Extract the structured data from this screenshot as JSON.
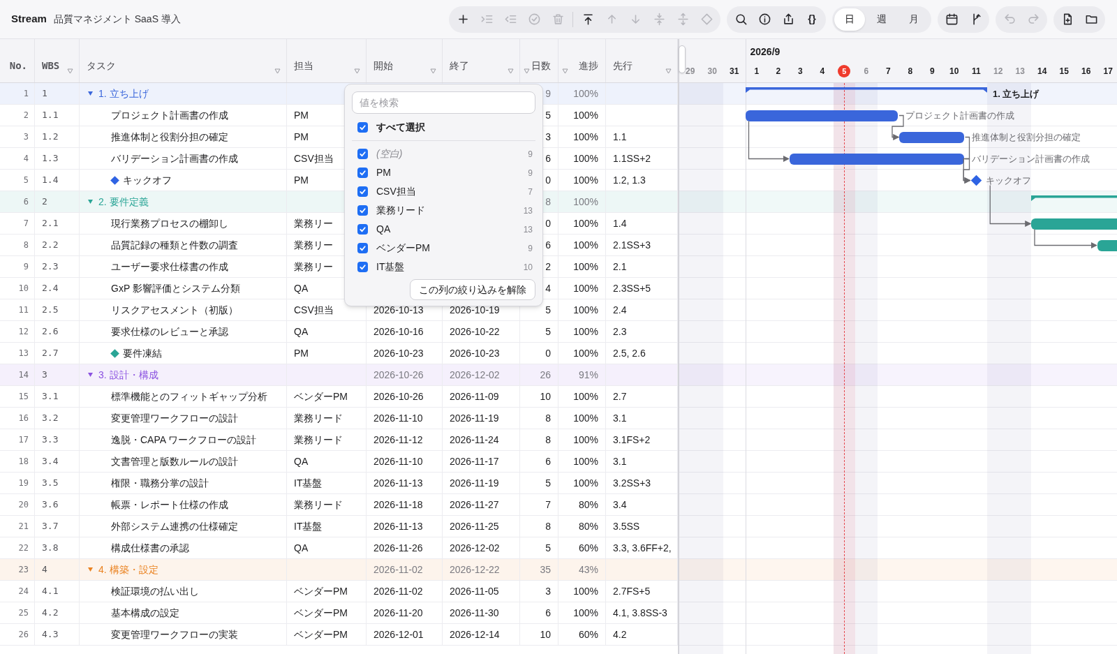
{
  "app": {
    "name": "Stream",
    "project": "品質マネジメント SaaS 導入"
  },
  "toolbar": {
    "groups": [
      {
        "kind": "icons",
        "items": [
          {
            "kind": "plus",
            "disabled": false
          },
          {
            "kind": "indent",
            "disabled": true
          },
          {
            "kind": "outdent",
            "disabled": true
          },
          {
            "kind": "check-circle",
            "disabled": true
          },
          {
            "kind": "trash",
            "disabled": true
          },
          {
            "kind": "separator"
          },
          {
            "kind": "move-top",
            "disabled": false
          },
          {
            "kind": "arrow-up",
            "disabled": true
          },
          {
            "kind": "arrow-down",
            "disabled": true
          },
          {
            "kind": "collapse",
            "disabled": true
          },
          {
            "kind": "expand",
            "disabled": true
          },
          {
            "kind": "diamond",
            "disabled": true
          }
        ]
      },
      {
        "kind": "icons",
        "items": [
          {
            "kind": "search",
            "disabled": false
          },
          {
            "kind": "info",
            "disabled": false
          },
          {
            "kind": "share",
            "disabled": false
          },
          {
            "kind": "text",
            "label": "{}",
            "disabled": false
          }
        ]
      },
      {
        "kind": "segmented",
        "options": [
          {
            "label": "日",
            "selected": true
          },
          {
            "label": "週",
            "selected": false
          },
          {
            "label": "月",
            "selected": false
          }
        ]
      },
      {
        "kind": "icons",
        "items": [
          {
            "kind": "calendar",
            "disabled": false
          },
          {
            "kind": "branch",
            "disabled": false
          }
        ]
      },
      {
        "kind": "icons",
        "items": [
          {
            "kind": "undo",
            "disabled": true
          },
          {
            "kind": "redo",
            "disabled": true
          }
        ]
      },
      {
        "kind": "icons",
        "items": [
          {
            "kind": "file-plus",
            "disabled": false
          },
          {
            "kind": "folder",
            "disabled": false
          }
        ]
      }
    ]
  },
  "table": {
    "columns": [
      {
        "label": "No.",
        "filter": false
      },
      {
        "label": "WBS",
        "filter": true
      },
      {
        "label": "タスク",
        "filter": true
      },
      {
        "label": "担当",
        "filter": true
      },
      {
        "label": "開始",
        "filter": true
      },
      {
        "label": "終了",
        "filter": true
      },
      {
        "label": "日数",
        "filter": true
      },
      {
        "label": "進捗",
        "filter": true
      },
      {
        "label": "先行",
        "filter": true
      }
    ],
    "rows": [
      {
        "kind": "group",
        "no": "1",
        "wbs": "1",
        "task": "1. 立ち上げ",
        "color": "#3a66db",
        "expanded": true,
        "days": "9",
        "progress": "100%",
        "bar": {
          "kind": "summary",
          "label": "1. 立ち上げ"
        },
        "children": [
          {
            "kind": "task",
            "no": "2",
            "wbs": "1.1",
            "task": "プロジェクト計画書の作成",
            "owner": "PM",
            "days": "5",
            "progress": "100%",
            "bar": {
              "kind": "task",
              "label": "プロジェクト計画書の作成"
            }
          },
          {
            "kind": "task",
            "no": "3",
            "wbs": "1.2",
            "task": "推進体制と役割分担の確定",
            "owner": "PM",
            "days": "3",
            "progress": "100%",
            "predecessor": "1.1",
            "bar": {
              "kind": "task",
              "label": "推進体制と役割分担の確定"
            }
          },
          {
            "kind": "task",
            "no": "4",
            "wbs": "1.3",
            "task": "バリデーション計画書の作成",
            "owner": "CSV担当",
            "days": "6",
            "progress": "100%",
            "predecessor": "1.1SS+2",
            "bar": {
              "kind": "task",
              "label": "バリデーション計画書の作成"
            }
          },
          {
            "kind": "milestone",
            "no": "5",
            "wbs": "1.4",
            "task": "キックオフ",
            "color": "#2f63e3",
            "owner": "PM",
            "days": "0",
            "progress": "100%",
            "predecessor": "1.2, 1.3",
            "bar": {
              "kind": "milestone",
              "label": "キックオフ"
            }
          }
        ]
      },
      {
        "kind": "group",
        "no": "6",
        "wbs": "2",
        "task": "2. 要件定義",
        "color": "#2aa596",
        "expanded": true,
        "days": "8",
        "progress": "100%",
        "bar": {
          "kind": "summary"
        },
        "children": [
          {
            "kind": "task",
            "no": "7",
            "wbs": "2.1",
            "task": "現行業務プロセスの棚卸し",
            "owner": "業務リー",
            "days": "0",
            "progress": "100%",
            "predecessor": "1.4",
            "bar": {
              "kind": "task"
            }
          },
          {
            "kind": "task",
            "no": "8",
            "wbs": "2.2",
            "task": "品質記録の種類と件数の調査",
            "owner": "業務リー",
            "days": "6",
            "progress": "100%",
            "predecessor": "2.1SS+3",
            "bar": {
              "kind": "task"
            }
          },
          {
            "kind": "task",
            "no": "9",
            "wbs": "2.3",
            "task": "ユーザー要求仕様書の作成",
            "owner": "業務リー",
            "days": "2",
            "progress": "100%",
            "predecessor": "2.1"
          },
          {
            "kind": "task",
            "no": "10",
            "wbs": "2.4",
            "task": "GxP 影響評価とシステム分類",
            "owner": "QA",
            "days": "4",
            "progress": "100%",
            "predecessor": "2.3SS+5"
          },
          {
            "kind": "task",
            "no": "11",
            "wbs": "2.5",
            "task": "リスクアセスメント（初版）",
            "owner": "CSV担当",
            "start": "2026-10-13",
            "end": "2026-10-19",
            "days": "5",
            "progress": "100%",
            "predecessor": "2.4"
          },
          {
            "kind": "task",
            "no": "12",
            "wbs": "2.6",
            "task": "要求仕様のレビューと承認",
            "owner": "QA",
            "start": "2026-10-16",
            "end": "2026-10-22",
            "days": "5",
            "progress": "100%",
            "predecessor": "2.3"
          },
          {
            "kind": "milestone",
            "no": "13",
            "wbs": "2.7",
            "task": "要件凍結",
            "color": "#2aa596",
            "owner": "PM",
            "start": "2026-10-23",
            "end": "2026-10-23",
            "days": "0",
            "progress": "100%",
            "predecessor": "2.5, 2.6"
          }
        ]
      },
      {
        "kind": "group",
        "no": "14",
        "wbs": "3",
        "task": "3. 設計・構成",
        "color": "#8b52e0",
        "expanded": true,
        "start": "2026-10-26",
        "end": "2026-12-02",
        "days": "26",
        "progress": "91%",
        "children": [
          {
            "kind": "task",
            "no": "15",
            "wbs": "3.1",
            "task": "標準機能とのフィットギャップ分析",
            "owner": "ベンダーPM",
            "start": "2026-10-26",
            "end": "2026-11-09",
            "days": "10",
            "progress": "100%",
            "predecessor": "2.7"
          },
          {
            "kind": "task",
            "no": "16",
            "wbs": "3.2",
            "task": "変更管理ワークフローの設計",
            "owner": "業務リード",
            "start": "2026-11-10",
            "end": "2026-11-19",
            "days": "8",
            "progress": "100%",
            "predecessor": "3.1"
          },
          {
            "kind": "task",
            "no": "17",
            "wbs": "3.3",
            "task": "逸脱・CAPA ワークフローの設計",
            "owner": "業務リード",
            "start": "2026-11-12",
            "end": "2026-11-24",
            "days": "8",
            "progress": "100%",
            "predecessor": "3.1FS+2"
          },
          {
            "kind": "task",
            "no": "18",
            "wbs": "3.4",
            "task": "文書管理と版数ルールの設計",
            "owner": "QA",
            "start": "2026-11-10",
            "end": "2026-11-17",
            "days": "6",
            "progress": "100%",
            "predecessor": "3.1"
          },
          {
            "kind": "task",
            "no": "19",
            "wbs": "3.5",
            "task": "権限・職務分掌の設計",
            "owner": "IT基盤",
            "start": "2026-11-13",
            "end": "2026-11-19",
            "days": "5",
            "progress": "100%",
            "predecessor": "3.2SS+3"
          },
          {
            "kind": "task",
            "no": "20",
            "wbs": "3.6",
            "task": "帳票・レポート仕様の作成",
            "owner": "業務リード",
            "start": "2026-11-18",
            "end": "2026-11-27",
            "days": "7",
            "progress": "80%",
            "predecessor": "3.4"
          },
          {
            "kind": "task",
            "no": "21",
            "wbs": "3.7",
            "task": "外部システム連携の仕様確定",
            "owner": "IT基盤",
            "start": "2026-11-13",
            "end": "2026-11-25",
            "days": "8",
            "progress": "80%",
            "predecessor": "3.5SS"
          },
          {
            "kind": "task",
            "no": "22",
            "wbs": "3.8",
            "task": "構成仕様書の承認",
            "owner": "QA",
            "start": "2026-11-26",
            "end": "2026-12-02",
            "days": "5",
            "progress": "60%",
            "predecessor": "3.3, 3.6FF+2,"
          }
        ]
      },
      {
        "kind": "group",
        "no": "23",
        "wbs": "4",
        "task": "4. 構築・設定",
        "color": "#ea8220",
        "expanded": true,
        "start": "2026-11-02",
        "end": "2026-12-22",
        "days": "35",
        "progress": "43%",
        "children": [
          {
            "kind": "task",
            "no": "24",
            "wbs": "4.1",
            "task": "検証環境の払い出し",
            "owner": "ベンダーPM",
            "start": "2026-11-02",
            "end": "2026-11-05",
            "days": "3",
            "progress": "100%",
            "predecessor": "2.7FS+5"
          },
          {
            "kind": "task",
            "no": "25",
            "wbs": "4.2",
            "task": "基本構成の設定",
            "owner": "ベンダーPM",
            "start": "2026-11-20",
            "end": "2026-11-30",
            "days": "6",
            "progress": "100%",
            "predecessor": "4.1, 3.8SS-3"
          },
          {
            "kind": "task",
            "no": "26",
            "wbs": "4.3",
            "task": "変更管理ワークフローの実装",
            "owner": "ベンダーPM",
            "start": "2026-12-01",
            "end": "2026-12-14",
            "days": "10",
            "progress": "60%",
            "predecessor": "4.2"
          }
        ]
      }
    ]
  },
  "filter": {
    "search": {
      "placeholder": "値を検索"
    },
    "select_all": {
      "label": "すべて選択",
      "checked": true
    },
    "options": [
      {
        "kind": "blank",
        "label": "(空白)",
        "count": "9",
        "checked": true
      },
      {
        "kind": "value",
        "label": "PM",
        "count": "9",
        "checked": true
      },
      {
        "kind": "value",
        "label": "CSV担当",
        "count": "7",
        "checked": true
      },
      {
        "kind": "value",
        "label": "業務リード",
        "count": "13",
        "checked": true
      },
      {
        "kind": "value",
        "label": "QA",
        "count": "13",
        "checked": true
      },
      {
        "kind": "value",
        "label": "ベンダーPM",
        "count": "9",
        "checked": true
      },
      {
        "kind": "value",
        "label": "IT基盤",
        "count": "10",
        "checked": true
      }
    ],
    "clear_button": "この列の絞り込みを解除"
  },
  "gantt": {
    "month": "2026/9",
    "days": [
      {
        "label": "29",
        "weekend": true
      },
      {
        "label": "30",
        "weekend": true
      },
      {
        "label": "31",
        "weekend": false
      },
      {
        "label": "1",
        "weekend": false,
        "month_start": true
      },
      {
        "label": "2",
        "weekend": false
      },
      {
        "label": "3",
        "weekend": false
      },
      {
        "label": "4",
        "weekend": false
      },
      {
        "label": "5",
        "weekend": true,
        "today": true
      },
      {
        "label": "6",
        "weekend": true
      },
      {
        "label": "7",
        "weekend": false
      },
      {
        "label": "8",
        "weekend": false
      },
      {
        "label": "9",
        "weekend": false
      },
      {
        "label": "10",
        "weekend": false
      },
      {
        "label": "11",
        "weekend": false
      },
      {
        "label": "12",
        "weekend": true
      },
      {
        "label": "13",
        "weekend": true
      },
      {
        "label": "14",
        "weekend": false
      },
      {
        "label": "15",
        "weekend": false
      },
      {
        "label": "16",
        "weekend": false
      },
      {
        "label": "17",
        "weekend": false
      }
    ]
  }
}
